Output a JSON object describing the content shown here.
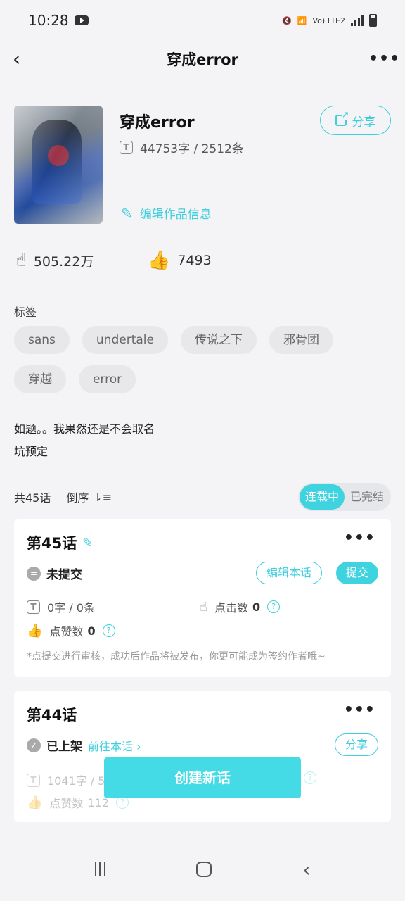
{
  "status": {
    "time": "10:28",
    "network": "Vo) LTE2"
  },
  "nav": {
    "title": "穿成error"
  },
  "book": {
    "title": "穿成error",
    "meta": "44753字 / 2512条",
    "share_label": "分享",
    "edit_label": "编辑作品信息"
  },
  "stats": {
    "reads": "505.22万",
    "likes": "7493"
  },
  "tags": {
    "label": "标签",
    "items": [
      "sans",
      "undertale",
      "传说之下",
      "邪骨团",
      "穿越",
      "error"
    ]
  },
  "description": [
    "如题。。我果然还是不会取名",
    "坑预定"
  ],
  "chapters_bar": {
    "count": "共45话",
    "sort": "倒序",
    "seg_ongoing": "连载中",
    "seg_finished": "已完结"
  },
  "chapters": [
    {
      "title": "第45话",
      "status": "未提交",
      "edit_label": "编辑本话",
      "submit_label": "提交",
      "words": "0字 / 0条",
      "clicks_label": "点击数",
      "clicks": "0",
      "likes_label": "点赞数",
      "likes": "0",
      "note": "*点提交进行审核，成功后作品将被发布，你更可能成为签约作者哦~"
    },
    {
      "title": "第44话",
      "status": "已上架",
      "goto_label": "前往本话",
      "share_label": "分享",
      "words": "1041字 / 5",
      "likes_label": "点赞数",
      "likes": "112"
    }
  ],
  "create_label": "创建新话",
  "colors": {
    "accent": "#3fcfdc",
    "accent_fill": "#44dbe6"
  }
}
